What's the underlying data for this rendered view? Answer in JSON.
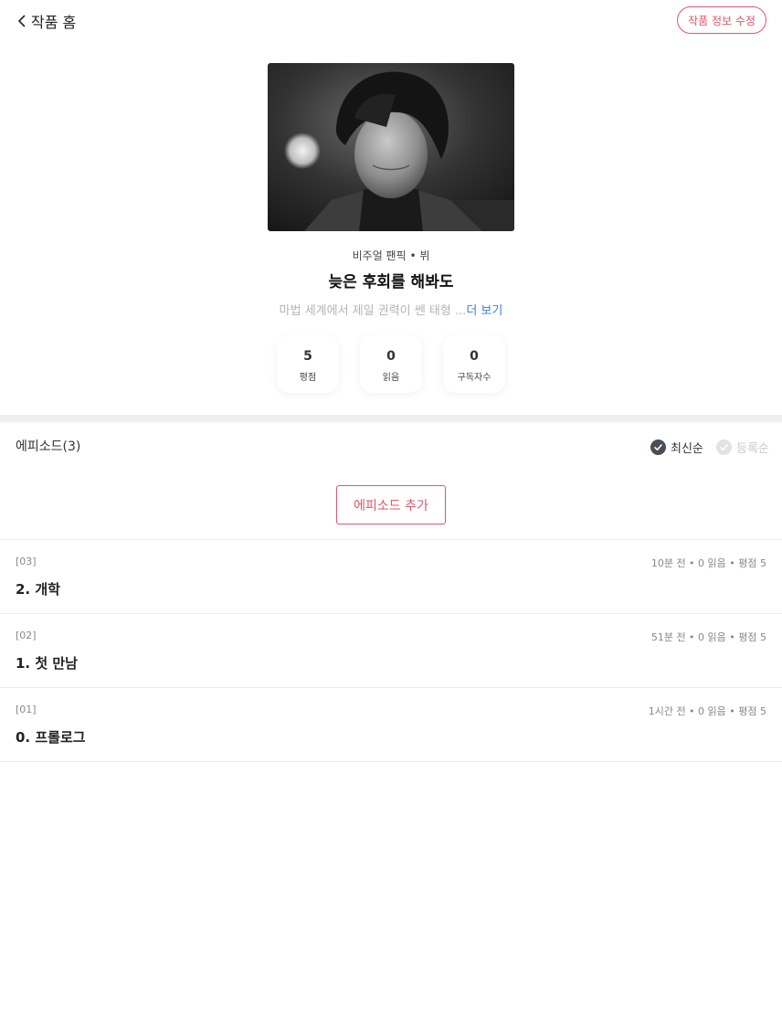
{
  "header": {
    "back_label": "작품 홈",
    "edit_info_label": "작품 정보 수정"
  },
  "work": {
    "category": "비주얼 팬픽 • 뷔",
    "title": "늦은 후회를 해봐도",
    "synopsis": "마법 세계에서 제일 권력이 쎈 태형 ...",
    "more_label": "더 보기"
  },
  "stats": [
    {
      "value": "5",
      "label": "평점"
    },
    {
      "value": "0",
      "label": "읽음"
    },
    {
      "value": "0",
      "label": "구독자수"
    }
  ],
  "episodes": {
    "header": "에피소드(3)",
    "sort_latest": "최신순",
    "sort_oldest": "등록순",
    "add_label": "에피소드 추가",
    "items": [
      {
        "number": "[03]",
        "meta": "10분 전 • 0 읽음 • 평점 5",
        "title": "2. 개학"
      },
      {
        "number": "[02]",
        "meta": "51분 전 • 0 읽음 • 평점 5",
        "title": "1. 첫 만남"
      },
      {
        "number": "[01]",
        "meta": "1시간 전 • 0 읽음 • 평점 5",
        "title": "0. 프롤로그"
      }
    ]
  },
  "colors": {
    "accent": "#e2546a",
    "link": "#3d7fd8",
    "check_active": "#4a4f57"
  }
}
